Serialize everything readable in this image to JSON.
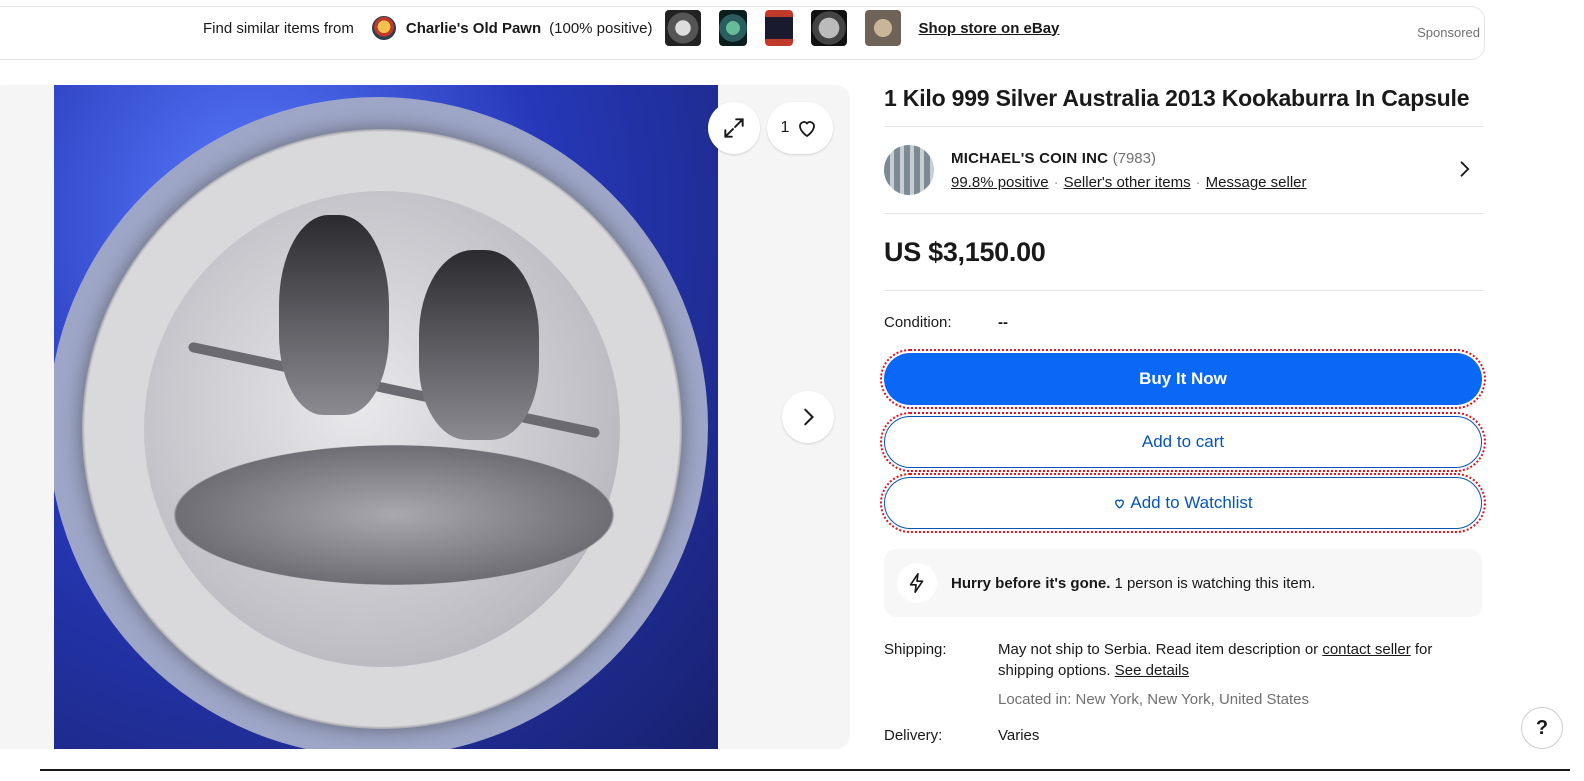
{
  "banner": {
    "find_label": "Find similar items from",
    "store_name": "Charlie's Old Pawn",
    "store_feedback": "(100% positive)",
    "shop_link": "Shop store on eBay",
    "sponsored": "Sponsored"
  },
  "gallery": {
    "watch_count": "1"
  },
  "listing": {
    "title": "1 Kilo 999 Silver Australia 2013 Kookaburra In Capsule",
    "seller": {
      "name": "MICHAEL'S COIN INC",
      "count": "(7983)",
      "positive": "99.8% positive",
      "other_items": "Seller's other items",
      "message": "Message seller"
    },
    "price": "US $3,150.00",
    "condition_label": "Condition:",
    "condition_value": "--",
    "buy_now": "Buy It Now",
    "add_to_cart": "Add to cart",
    "add_to_watchlist": "Add to Watchlist",
    "hurry_bold": "Hurry before it's gone.",
    "hurry_text": "1 person is watching this item.",
    "shipping_label": "Shipping:",
    "shipping_text_1": "May not ship to Serbia. Read item description or ",
    "contact_seller": "contact seller",
    "shipping_text_2": " for shipping options. ",
    "see_details": "See details",
    "located": "Located in: New York, New York, United States",
    "delivery_label": "Delivery:",
    "delivery_value": "Varies"
  },
  "help": "?",
  "colors": {
    "buy_button": "#0968f6",
    "link_blue": "#0654ba",
    "focus_outline": "#e0141e"
  }
}
